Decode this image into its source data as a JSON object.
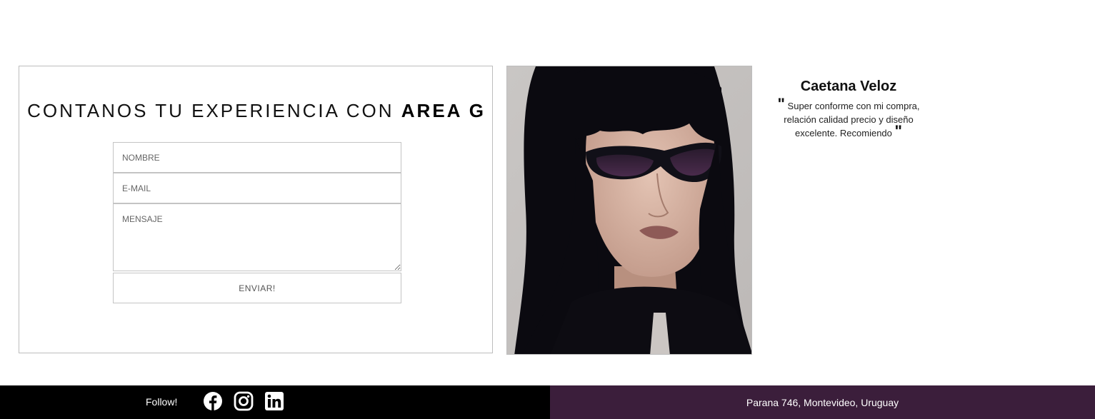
{
  "contact_form": {
    "title_prefix": "CONTANOS TU EXPERIENCIA CON",
    "title_brand": "AREA G",
    "name_placeholder": "NOMBRE",
    "email_placeholder": "E-MAIL",
    "message_placeholder": "MENSAJE",
    "submit_label": "ENVIAR!"
  },
  "photo": {
    "icon": "portrait-woman-sunglasses"
  },
  "testimonial": {
    "author": "Caetana Veloz",
    "quote_open": "\"",
    "text": "Super conforme con mi compra, relación calidad precio y diseño excelente. Recomiendo",
    "quote_close": "\""
  },
  "footer": {
    "follow_label": "Follow!",
    "social": [
      {
        "icon": "facebook-icon"
      },
      {
        "icon": "instagram-icon"
      },
      {
        "icon": "linkedin-icon"
      }
    ],
    "address": "Parana 746, Montevideo, Uruguay",
    "colors": {
      "left_bg": "#000000",
      "right_bg": "#3b1e3b"
    }
  }
}
